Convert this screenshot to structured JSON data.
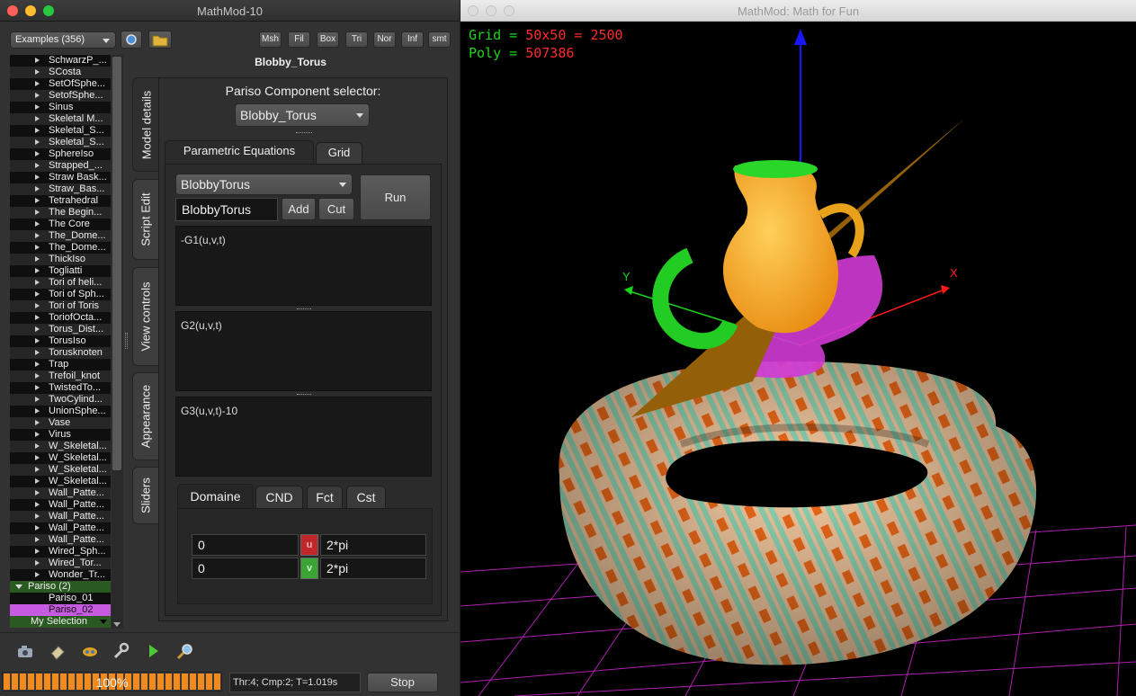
{
  "left_window": {
    "title": "MathMod-10",
    "examples_combo": "Examples (356)",
    "toolbar_buttons": [
      "Msh",
      "Fil",
      "Box",
      "Tri",
      "Nor",
      "Inf",
      "smt"
    ],
    "model_title": "Blobby_Torus",
    "tree_items": [
      "SchwarzP_...",
      "SCosta",
      "SetOfSphe...",
      "SetofSphe...",
      "Sinus",
      "Skeletal M...",
      "Skeletal_S...",
      "Skeletal_S...",
      "SphereIso",
      "Strapped_...",
      "Straw Bask...",
      "Straw_Bas...",
      "Tetrahedral",
      "The Begin...",
      "The Core",
      "The_Dome...",
      "The_Dome...",
      "ThickIso",
      "Togliatti",
      "Tori of heli...",
      "Tori of Sph...",
      "Tori of Toris",
      "ToriofOcta...",
      "Torus_Dist...",
      "TorusIso",
      "Torusknoten",
      "Trap",
      "Trefoil_knot",
      "TwistedTo...",
      "TwoCylind...",
      "UnionSphe...",
      "Vase",
      "Virus",
      "W_Skeletal...",
      "W_Skeletal...",
      "W_Skeletal...",
      "W_Skeletal...",
      "Wall_Patte...",
      "Wall_Patte...",
      "Wall_Patte...",
      "Wall_Patte...",
      "Wall_Patte...",
      "Wired_Sph...",
      "Wired_Tor...",
      "Wonder_Tr..."
    ],
    "pariso_group": "Pariso (2)",
    "pariso_items": [
      "Pariso_01",
      "Pariso_02"
    ],
    "my_selection": "My Selection",
    "side_tabs": [
      "Model details",
      "Script Edit",
      "View controls",
      "Appearance",
      "Sliders"
    ],
    "component_selector_label": "Pariso Component selector:",
    "component_combo": "Blobby_Torus",
    "eq_tabs": [
      "Parametric Equations",
      "Grid"
    ],
    "name_combo": "BlobbyTorus",
    "name_input": "BlobbyTorus",
    "add_label": "Add",
    "cut_label": "Cut",
    "run_label": "Run",
    "equations": [
      "-G1(u,v,t)",
      "G2(u,v,t)",
      "G3(u,v,t)-10"
    ],
    "domain_tabs": [
      "Domaine",
      "CND",
      "Fct",
      "Cst"
    ],
    "domain_rows": [
      {
        "min": "0",
        "var": "u",
        "max": "2*pi",
        "color": "#c0262a"
      },
      {
        "min": "0",
        "var": "v",
        "max": "2*pi",
        "color": "#3aa535"
      }
    ],
    "progress_percent": 100,
    "progress_text": "100%",
    "status_text": "Thr:4; Cmp:2; T=1.019s",
    "stop_label": "Stop"
  },
  "right_window": {
    "title": "MathMod: Math for Fun",
    "hud_grid_label": "Grid = ",
    "hud_grid_value": "50x50 = 2500",
    "hud_poly_label": "Poly = ",
    "hud_poly_value": "507386",
    "axis_x": "X",
    "axis_y": "Y"
  },
  "colors": {
    "traffic_red": "#ff5f57",
    "traffic_yellow": "#febc2e",
    "traffic_green": "#28c840",
    "selected_item": "#c65ae0",
    "group_green": "#2a5a22",
    "hud_green": "#1ed61e",
    "hud_red": "#ff2a2a",
    "progress_orange": "#f08a1c"
  }
}
